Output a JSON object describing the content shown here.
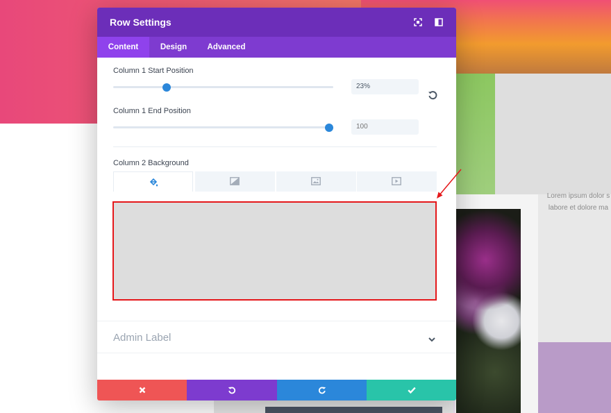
{
  "background_page": {
    "lorem_line1": "Lorem ipsum dolor s",
    "lorem_line2": "labore et dolore ma"
  },
  "modal": {
    "title": "Row Settings",
    "header_icons": [
      "fullscreen-icon",
      "sidebar-layout-icon"
    ],
    "tabs": [
      {
        "label": "Content",
        "active": true
      },
      {
        "label": "Design",
        "active": false
      },
      {
        "label": "Advanced",
        "active": false
      }
    ],
    "fields": {
      "start_position": {
        "label": "Column 1 Start Position",
        "value": "23%",
        "slider_percent": 23
      },
      "end_position": {
        "label": "Column 1 End Position",
        "placeholder": "100",
        "slider_percent": 100
      },
      "column2_background": {
        "label": "Column 2 Background",
        "tabs": [
          "paint-bucket-icon",
          "gradient-icon",
          "image-icon",
          "video-icon"
        ],
        "active_tab": 0,
        "preview_color": "#dddddd"
      }
    },
    "admin_label": "Admin Label",
    "footer": {
      "buttons": [
        {
          "name": "cancel",
          "icon": "close-icon",
          "color": "#ef5555"
        },
        {
          "name": "undo",
          "icon": "undo-icon",
          "color": "#7d3bcf"
        },
        {
          "name": "redo",
          "icon": "redo-icon",
          "color": "#2b87da"
        },
        {
          "name": "save",
          "icon": "check-icon",
          "color": "#29c4a9"
        }
      ]
    }
  },
  "colors": {
    "header": "#6c2eb9",
    "tabs_bar": "#7e3bd0",
    "active_tab": "#8f42ec",
    "accent_blue": "#2b87da",
    "highlight_red": "#e5171a"
  }
}
